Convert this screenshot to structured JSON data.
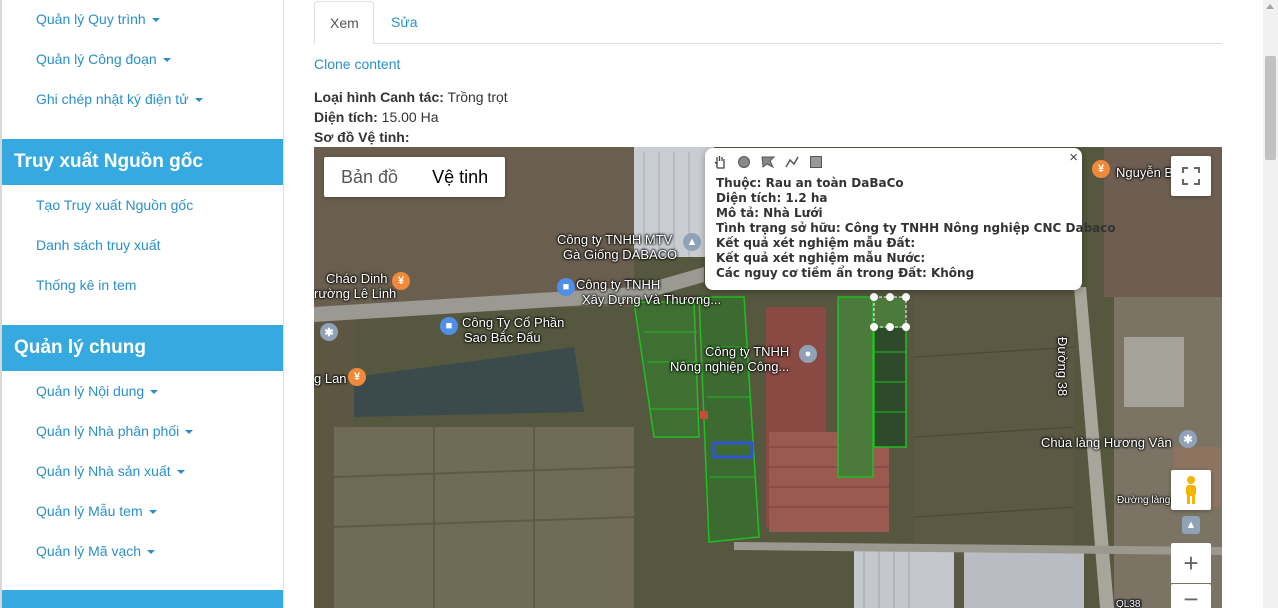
{
  "sidebar": {
    "group1_items": [
      {
        "label": "Quản lý Quy trình"
      },
      {
        "label": "Quản lý Công đoạn"
      },
      {
        "label": "Ghi chép nhật ký điện tử"
      }
    ],
    "section_traceability": {
      "title": "Truy xuất Nguồn gốc",
      "items": [
        {
          "label": "Tạo Truy xuất Nguồn gốc"
        },
        {
          "label": "Danh sách truy xuất"
        },
        {
          "label": "Thống kê in tem"
        }
      ]
    },
    "section_general": {
      "title": "Quản lý chung",
      "items": [
        {
          "label": "Quản lý Nội dung"
        },
        {
          "label": "Quản lý Nhà phân phối"
        },
        {
          "label": "Quản lý Nhà sản xuất"
        },
        {
          "label": "Quản lý Mẫu tem"
        },
        {
          "label": "Quản lý Mã vạch"
        }
      ]
    }
  },
  "tabs": {
    "view": "Xem",
    "edit": "Sửa"
  },
  "clone_link": "Clone content",
  "info": {
    "farming_type_label": "Loại hình Canh tác:",
    "farming_type_value": "Trồng trọt",
    "area_label": "Diện tích:",
    "area_value": "15.00 Ha",
    "satellite_label": "Sơ đồ Vệ tinh:"
  },
  "map": {
    "type_map": "Bản đồ",
    "type_satellite": "Vệ tinh",
    "places": {
      "p1": "Công ty TNHH MTV",
      "p1b": "Gà Giống DABACO",
      "p2": "Cháo Dinh",
      "p2b": "rường Lê Linh",
      "p3": "Công ty TNHH",
      "p3b": "Xây Dựng Và Thương...",
      "p4": "Công Ty Cổ Phần",
      "p4b": "Sao Bắc Đẩu",
      "p5": "Công ty TNHH",
      "p5b": "Nông nghiệp Công...",
      "p6": "Nguyễn B",
      "p7": "Đường 38",
      "p8": "Chùa làng Hương Vân",
      "p9": "Đường làng",
      "p10": "g Lan",
      "p11": "QL38"
    },
    "popup": {
      "belongs": "Thuộc: Rau an toàn DaBaCo",
      "area": "Diện tích: 1.2 ha",
      "desc": "Mô tả: Nhà Lưới",
      "ownership": "Tình trạng sở hữu: Công ty TNHH Nông nghiệp CNC Dabaco",
      "soil": "Kết quả xét nghiệm mẫu Đất:",
      "water": "Kết quả xét nghiệm mẫu Nước:",
      "risk": "Các nguy cơ tiềm ẩn trong Đất: Không",
      "close": "×"
    },
    "zoom_in": "+",
    "zoom_out": "−"
  }
}
